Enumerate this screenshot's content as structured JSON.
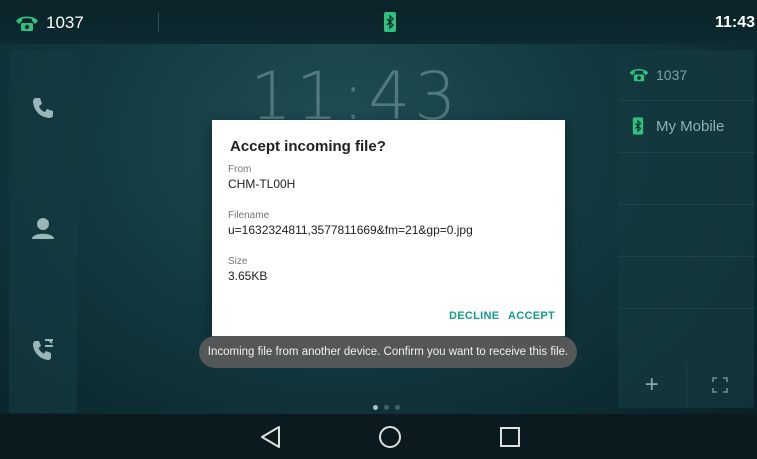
{
  "status_bar": {
    "account_number": "1037",
    "clock": "11:43",
    "account_icon": "phone-icon",
    "bluetooth_icon": "bluetooth-icon"
  },
  "background": {
    "big_clock": "11:43"
  },
  "left_panel": {
    "items": [
      {
        "icon": "phone-icon"
      },
      {
        "icon": "contacts-icon"
      },
      {
        "icon": "call-log-icon"
      }
    ]
  },
  "right_panel": {
    "line_label": "1037",
    "mobile_label": "My Mobile",
    "add_icon": "plus-icon",
    "add_glyph": "+",
    "expand_icon": "expand-icon"
  },
  "dialog": {
    "title": "Accept incoming file?",
    "from_label": "From",
    "from_value": "CHM-TL00H",
    "filename_label": "Filename",
    "filename_value": "u=1632324811,3577811669&fm=21&gp=0.jpg",
    "size_label": "Size",
    "size_value": "3.65KB",
    "decline_label": "DECLINE",
    "accept_label": "ACCEPT"
  },
  "toast": {
    "text": "Incoming file from another device. Confirm you want to receive this file."
  },
  "nav_bar": {
    "back_icon": "back-icon",
    "home_icon": "home-icon",
    "recent_icon": "recent-apps-icon"
  },
  "colors": {
    "accent": "#169c8a",
    "phone_green": "#2ec27e",
    "background": "#133b42"
  }
}
